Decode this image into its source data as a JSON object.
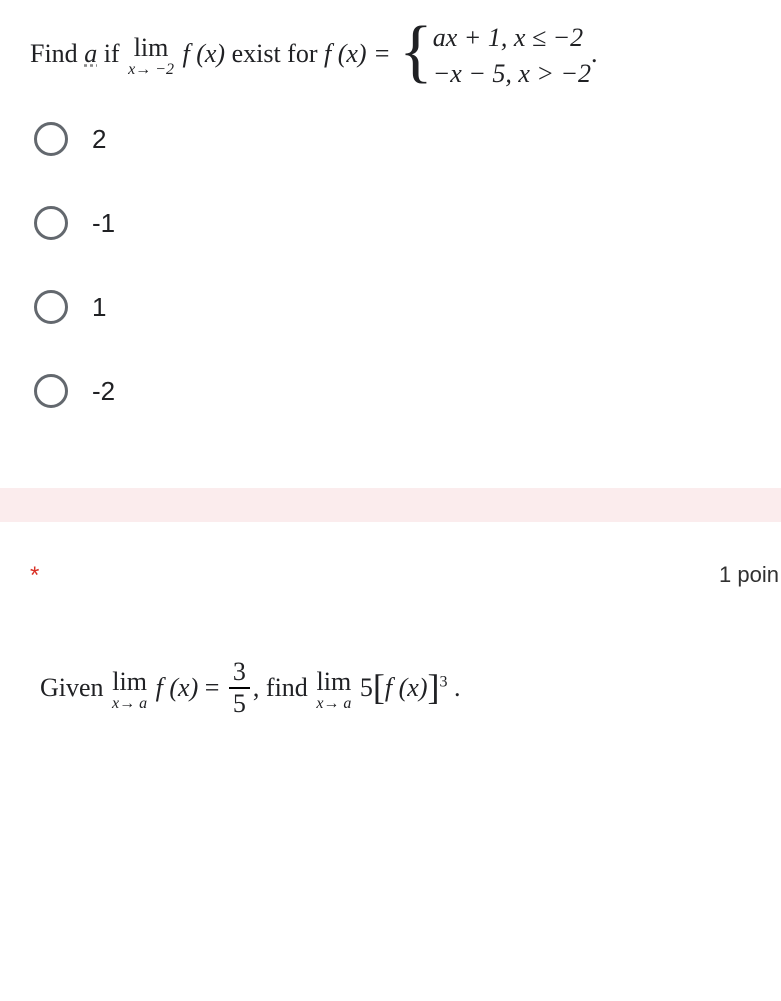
{
  "q1": {
    "prefix": "Find ",
    "a_under": "a",
    "mid1": " if  ",
    "lim_label": "lim",
    "lim_sub": "x→ −2",
    "fx": "f (x)",
    "exist": " exist for  ",
    "eq": "f (x) = ",
    "case1": "ax + 1,    x ≤ −2",
    "case2": "−x − 5,   x > −2",
    "period": ".",
    "options": [
      "2",
      "-1",
      "1",
      "-2"
    ]
  },
  "q2_header": {
    "asterisk": "*",
    "points": "1 poin"
  },
  "q2": {
    "given": "Given  ",
    "lim_label": "lim",
    "lim_sub": "x→ a",
    "fx": "f (x)",
    "eq": " = ",
    "frac_num": "3",
    "frac_den": "5",
    "comma": ",  find  ",
    "five": "5",
    "lbr": "[",
    "rbr": "]",
    "cube": "3",
    "period": " ."
  }
}
